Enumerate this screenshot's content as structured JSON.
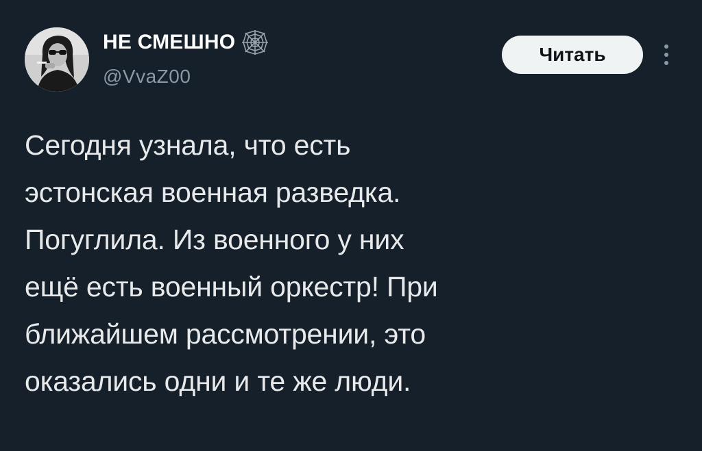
{
  "tweet": {
    "author": {
      "display_name": "НЕ СМЕШНО",
      "handle": "@VvaZ00",
      "badge_icon": "spider-web-icon",
      "avatar_icon": "avatar-woman-smoking"
    },
    "follow_label": "Читать",
    "more_icon": "more-vertical-icon",
    "text": "Сегодня узнала, что есть\nэстонская военная разведка.\nПогуглила. Из военного у них\nещё есть военный оркестр! При\nближайшем рассмотрении, это\nоказались одни и те же люди."
  },
  "colors": {
    "background": "#15202b",
    "text_primary": "#e7e9ea",
    "text_secondary": "#8b98a5",
    "button_bg": "#eff3f4",
    "button_text": "#0f1419"
  }
}
